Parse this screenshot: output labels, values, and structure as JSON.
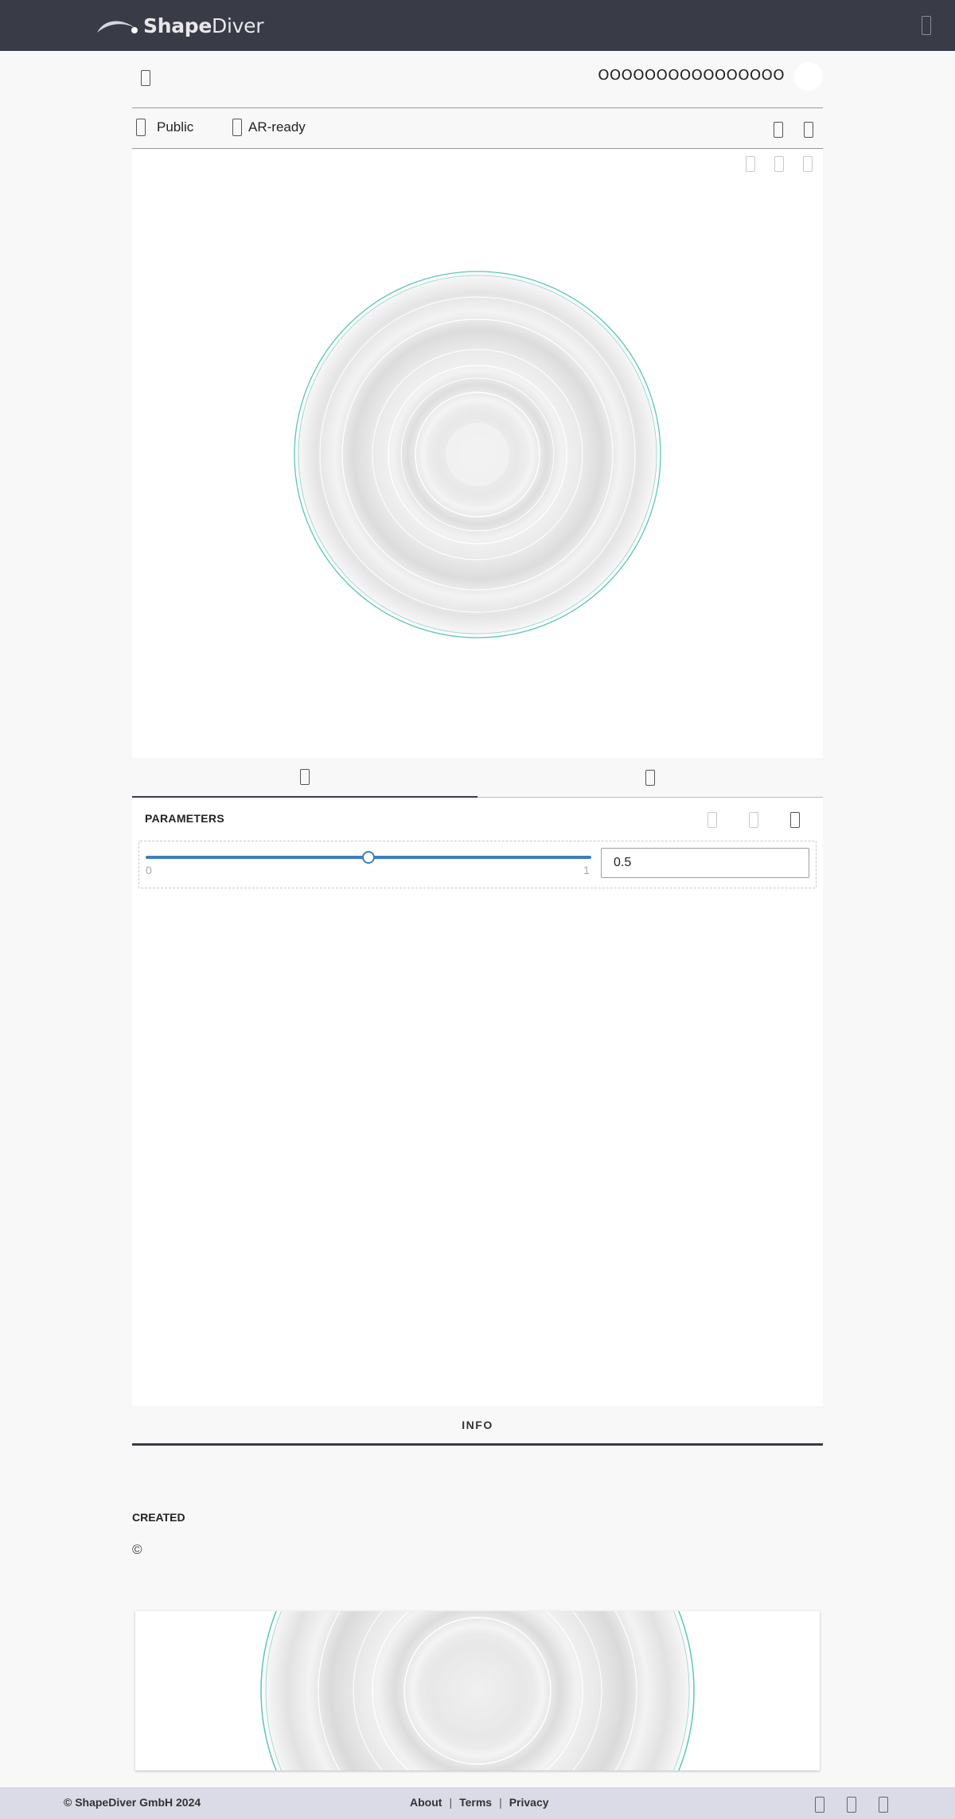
{
  "brand": {
    "name_bold": "Shape",
    "name_rest": "Diver",
    "logo_icon": "shapediver-swoosh-logo",
    "menu_icon": "hamburger-menu-icon"
  },
  "model": {
    "title": "OOOOOOOOOOOOOOOO",
    "back_icon": "back-arrow-icon",
    "avatar_icon": "user-avatar-icon"
  },
  "badges": [
    {
      "label": "Public",
      "icon": "globe-icon"
    },
    {
      "label": "AR-ready",
      "icon": "ar-cube-icon"
    }
  ],
  "header_actions": [
    "share-icon",
    "more-options-icon"
  ],
  "viewer": {
    "toolbar_icons": [
      "camera-reset-icon",
      "zoom-extents-icon",
      "fullscreen-icon"
    ],
    "rim_color": "#5cc6b6"
  },
  "tabs": [
    {
      "icon": "sliders-icon",
      "active": true
    },
    {
      "icon": "download-icon",
      "active": false
    }
  ],
  "parameters": {
    "title": "PARAMETERS",
    "header_icons": [
      "undo-icon",
      "redo-icon",
      "reset-icon"
    ],
    "slider": {
      "min_label": "0",
      "max_label": "1",
      "value": "0.5",
      "fraction": 0.5
    }
  },
  "info": {
    "tab_label": "INFO"
  },
  "created": {
    "label": "CREATED",
    "copyright": "©"
  },
  "footer": {
    "copyright": "© ShapeDiver GmbH 2024",
    "links": [
      "About",
      "Terms",
      "Privacy"
    ],
    "social_icons": [
      "linkedin-icon",
      "twitter-icon",
      "youtube-icon"
    ]
  },
  "colors": {
    "topbar": "#393b47",
    "accent_blue": "#3d7ec2",
    "footer_bg": "#dadbe6",
    "page_bg": "#f8f8f8"
  }
}
